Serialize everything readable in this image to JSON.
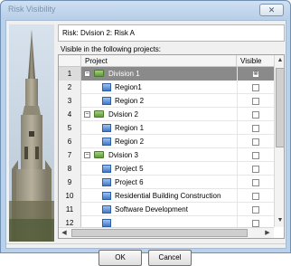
{
  "window": {
    "title": "Risk Visibility",
    "close_glyph": "✕"
  },
  "risk": {
    "label": "Risk: Dvision 2: Risk A"
  },
  "visible_in_projects_label": "Visible in the following projects:",
  "grid": {
    "headers": {
      "project": "Project",
      "visible": "Visible"
    },
    "rows": [
      {
        "num": "1",
        "name": "Division 1",
        "level": 0,
        "kind": "folder",
        "expander": "−",
        "visible_mark": "⊗",
        "selected": true
      },
      {
        "num": "2",
        "name": "Region1",
        "level": 1,
        "kind": "region",
        "visible_mark": ""
      },
      {
        "num": "3",
        "name": "Region 2",
        "level": 1,
        "kind": "region",
        "visible_mark": ""
      },
      {
        "num": "4",
        "name": "Dvision 2",
        "level": 0,
        "kind": "folder",
        "expander": "−",
        "visible_mark": ""
      },
      {
        "num": "5",
        "name": "Region 1",
        "level": 1,
        "kind": "region",
        "visible_mark": ""
      },
      {
        "num": "6",
        "name": "Region 2",
        "level": 1,
        "kind": "region",
        "visible_mark": ""
      },
      {
        "num": "7",
        "name": "Dvision 3",
        "level": 0,
        "kind": "folder",
        "expander": "−",
        "visible_mark": ""
      },
      {
        "num": "8",
        "name": "Project 5",
        "level": 1,
        "kind": "region",
        "visible_mark": ""
      },
      {
        "num": "9",
        "name": "Project 6",
        "level": 1,
        "kind": "region",
        "visible_mark": ""
      },
      {
        "num": "10",
        "name": "Residential Building Construction",
        "level": 1,
        "kind": "region",
        "visible_mark": ""
      },
      {
        "num": "11",
        "name": "Software Development",
        "level": 1,
        "kind": "region",
        "visible_mark": ""
      },
      {
        "num": "12",
        "name": "",
        "level": 1,
        "kind": "region",
        "visible_mark": ""
      }
    ],
    "scroll": {
      "up": "▲",
      "down": "▼",
      "left": "◀",
      "right": "▶"
    }
  },
  "buttons": {
    "ok": "OK",
    "cancel": "Cancel"
  },
  "colors": {
    "selected_row": "#8a8a8a",
    "window_frame": "#b9d1ea"
  }
}
